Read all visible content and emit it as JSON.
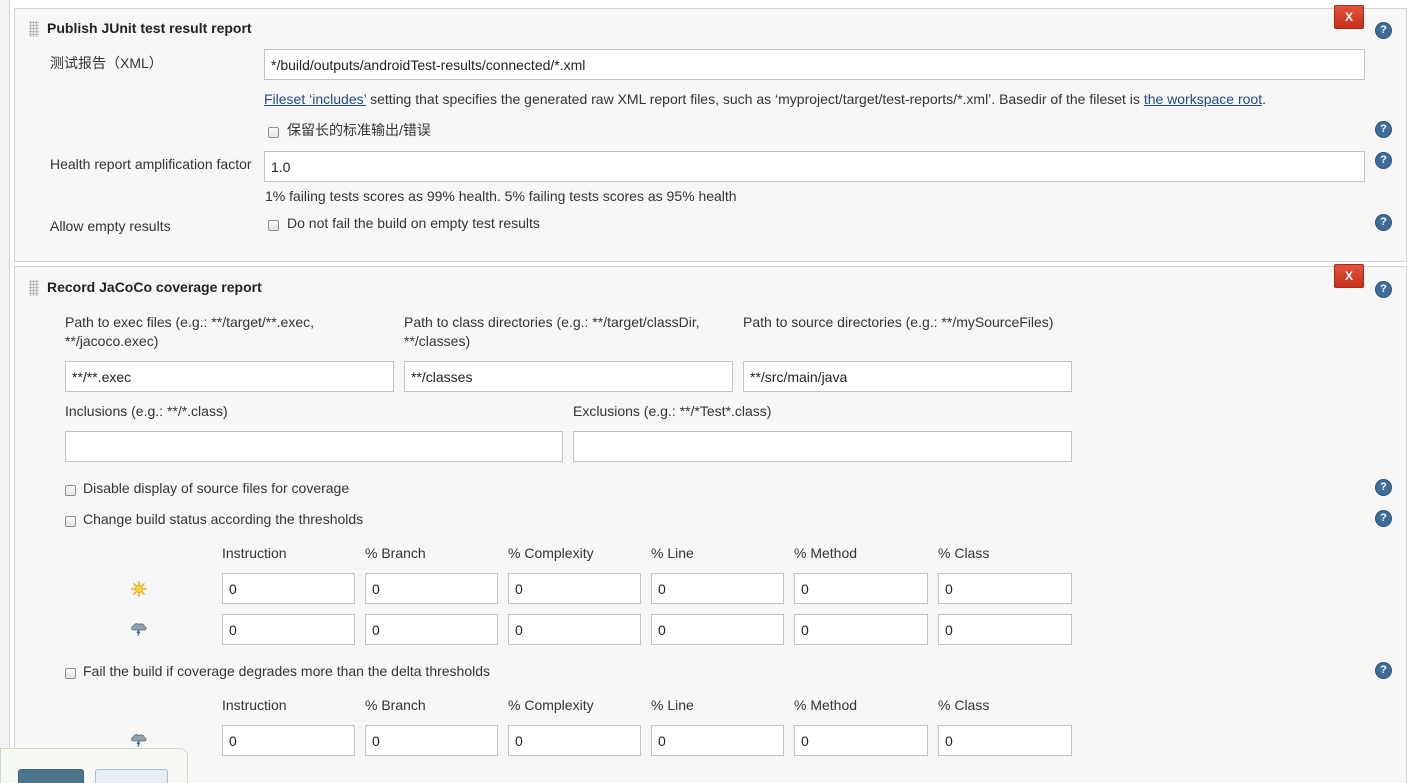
{
  "colors": {
    "delete_button": "#c9361f",
    "help_icon": "#3d6d9b",
    "link": "#204a87",
    "section_bg": "#f7f7f7"
  },
  "junit": {
    "title": "Publish JUnit test result report",
    "delete_label": "X",
    "help_label": "?",
    "test_report_label": "测试报告（XML）",
    "test_report_value": "*/build/outputs/androidTest-results/connected/*.xml",
    "fileset_link": "Fileset ‘includes’",
    "fileset_desc": " setting that specifies the generated raw XML report files, such as ‘myproject/target/test-reports/*.xml’. Basedir of the fileset is ",
    "workspace_link": "the workspace root",
    "fileset_end": ".",
    "keep_stdio_label": "保留长的标准输出/错误",
    "health_label": "Health report amplification factor",
    "health_value": "1.0",
    "health_desc": "1% failing tests scores as 99% health. 5% failing tests scores as 95% health",
    "allow_empty_label": "Allow empty results",
    "allow_empty_checkbox": "Do not fail the build on empty test results"
  },
  "jacoco": {
    "title": "Record JaCoCo coverage report",
    "delete_label": "X",
    "help_label": "?",
    "exec_label_1": "Path to exec files (e.g.: **/target/**.exec,",
    "exec_label_2": "**/jacoco.exec)",
    "exec_value": "**/**.exec",
    "class_label_1": "Path to class directories (e.g.: **/target/classDir,",
    "class_label_2": "**/classes)",
    "class_value": "**/classes",
    "source_label": "Path to source directories (e.g.: **/mySourceFiles)",
    "source_value": "**/src/main/java",
    "inclusions_label": "Inclusions (e.g.: **/*.class)",
    "inclusions_value": "",
    "exclusions_label": "Exclusions (e.g.: **/*Test*.class)",
    "exclusions_value": "",
    "disable_source_label": "Disable display of source files for coverage",
    "change_status_label": "Change build status according the thresholds",
    "threshold_headers": [
      "Instruction",
      "% Branch",
      "% Complexity",
      "% Line",
      "% Method",
      "% Class"
    ],
    "sunny_values": [
      "0",
      "0",
      "0",
      "0",
      "0",
      "0"
    ],
    "stormy_values": [
      "0",
      "0",
      "0",
      "0",
      "0",
      "0"
    ],
    "fail_delta_label": "Fail the build if coverage degrades more than the delta thresholds",
    "delta_headers": [
      "Instruction",
      "% Branch",
      "% Complexity",
      "% Line",
      "% Method",
      "% Class"
    ],
    "delta_values": [
      "0",
      "0",
      "0",
      "0",
      "0",
      "0"
    ]
  }
}
